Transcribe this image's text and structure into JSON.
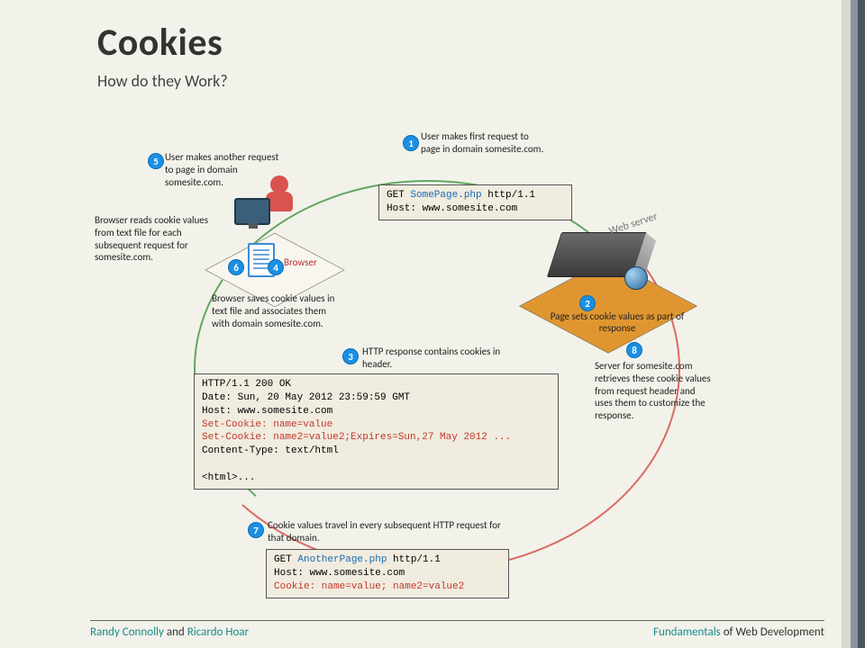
{
  "title": "Cookies",
  "subtitle": "How do they Work?",
  "footer": {
    "author1": "Randy Connolly",
    "and": " and ",
    "author2": "Ricardo Hoar",
    "book_highlight": "Fundamentals",
    "book_rest": " of Web Development"
  },
  "labels": {
    "browser": "Browser",
    "server": "Web server",
    "server_caption": "Page sets cookie values as part of response"
  },
  "steps": {
    "s1": "User makes first request to page in  domain somesite.com.",
    "s2_badge": "2",
    "s3": "HTTP response contains cookies in header.",
    "s4_badge": "4",
    "s4_text": "Browser saves cookie values in text file and associates them with domain somesite.com.",
    "s5": "User makes another request to page in domain somesite.com.",
    "s6_badge": "6",
    "s6_text": "Browser reads cookie values from text file for each subsequent request for somesite.com.",
    "s7": "Cookie values travel in every subsequent HTTP request for that domain.",
    "s8_badge": "8",
    "s8_text": "Server for somesite.com retrieves these cookie values from request header and uses them to customize the response."
  },
  "code": {
    "req1_l1a": "GET ",
    "req1_l1b": "SomePage.php",
    "req1_l1c": " http/1.1",
    "req1_l2": "Host: www.somesite.com",
    "resp_l1": "HTTP/1.1 200 OK",
    "resp_l2": "Date: Sun, 20 May 2012 23:59:59 GMT",
    "resp_l3": "Host: www.somesite.com",
    "resp_l4": "Set-Cookie: name=value",
    "resp_l5": "Set-Cookie: name2=value2;Expires=Sun,27 May 2012 ...",
    "resp_l6": "Content-Type: text/html",
    "resp_l7": "<html>...",
    "req2_l1a": "GET ",
    "req2_l1b": "AnotherPage.php",
    "req2_l1c": " http/1.1",
    "req2_l2": "Host: www.somesite.com",
    "req2_l3": "Cookie: name=value; name2=value2"
  }
}
